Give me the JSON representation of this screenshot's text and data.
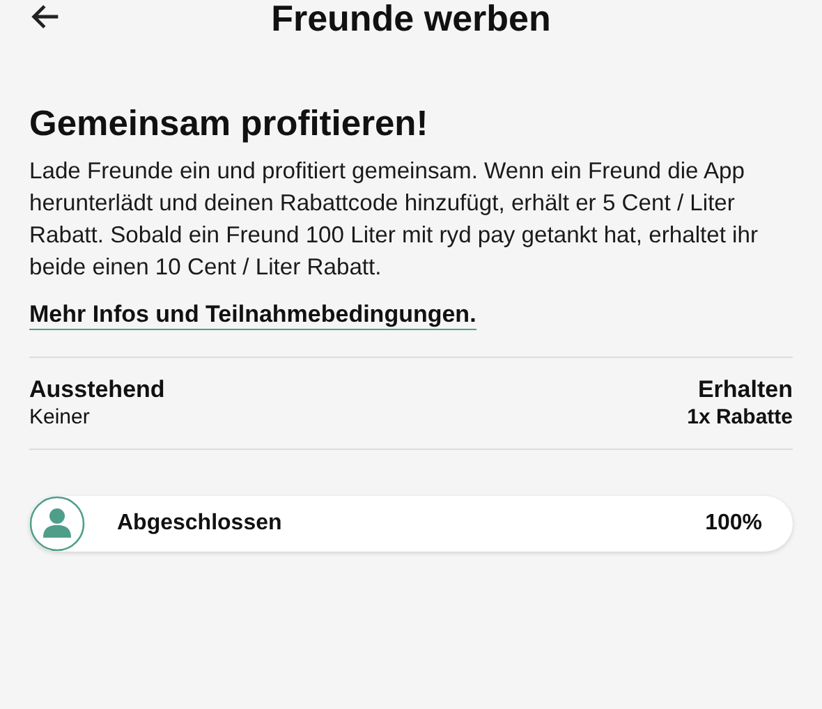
{
  "header": {
    "title": "Freunde werben"
  },
  "heading": "Gemeinsam profitieren!",
  "description": "Lade Freunde ein und profitiert gemeinsam. Wenn ein Freund die App herunterlädt und deinen Rabattcode hinzufügt, erhält er 5 Cent / Liter Rabatt. Sobald ein Freund 100 Liter mit ryd pay getankt hat, erhaltet ihr beide einen 10 Cent / Liter Rabatt.",
  "info_link": "Mehr Infos und Teilnahmebedingungen.",
  "stats": [
    {
      "label": "Ausstehend",
      "value": "Keiner"
    },
    {
      "label": "Erhalten",
      "value": "1x Rabatte"
    }
  ],
  "progress": {
    "label": "Abgeschlossen",
    "reading": "100%"
  }
}
